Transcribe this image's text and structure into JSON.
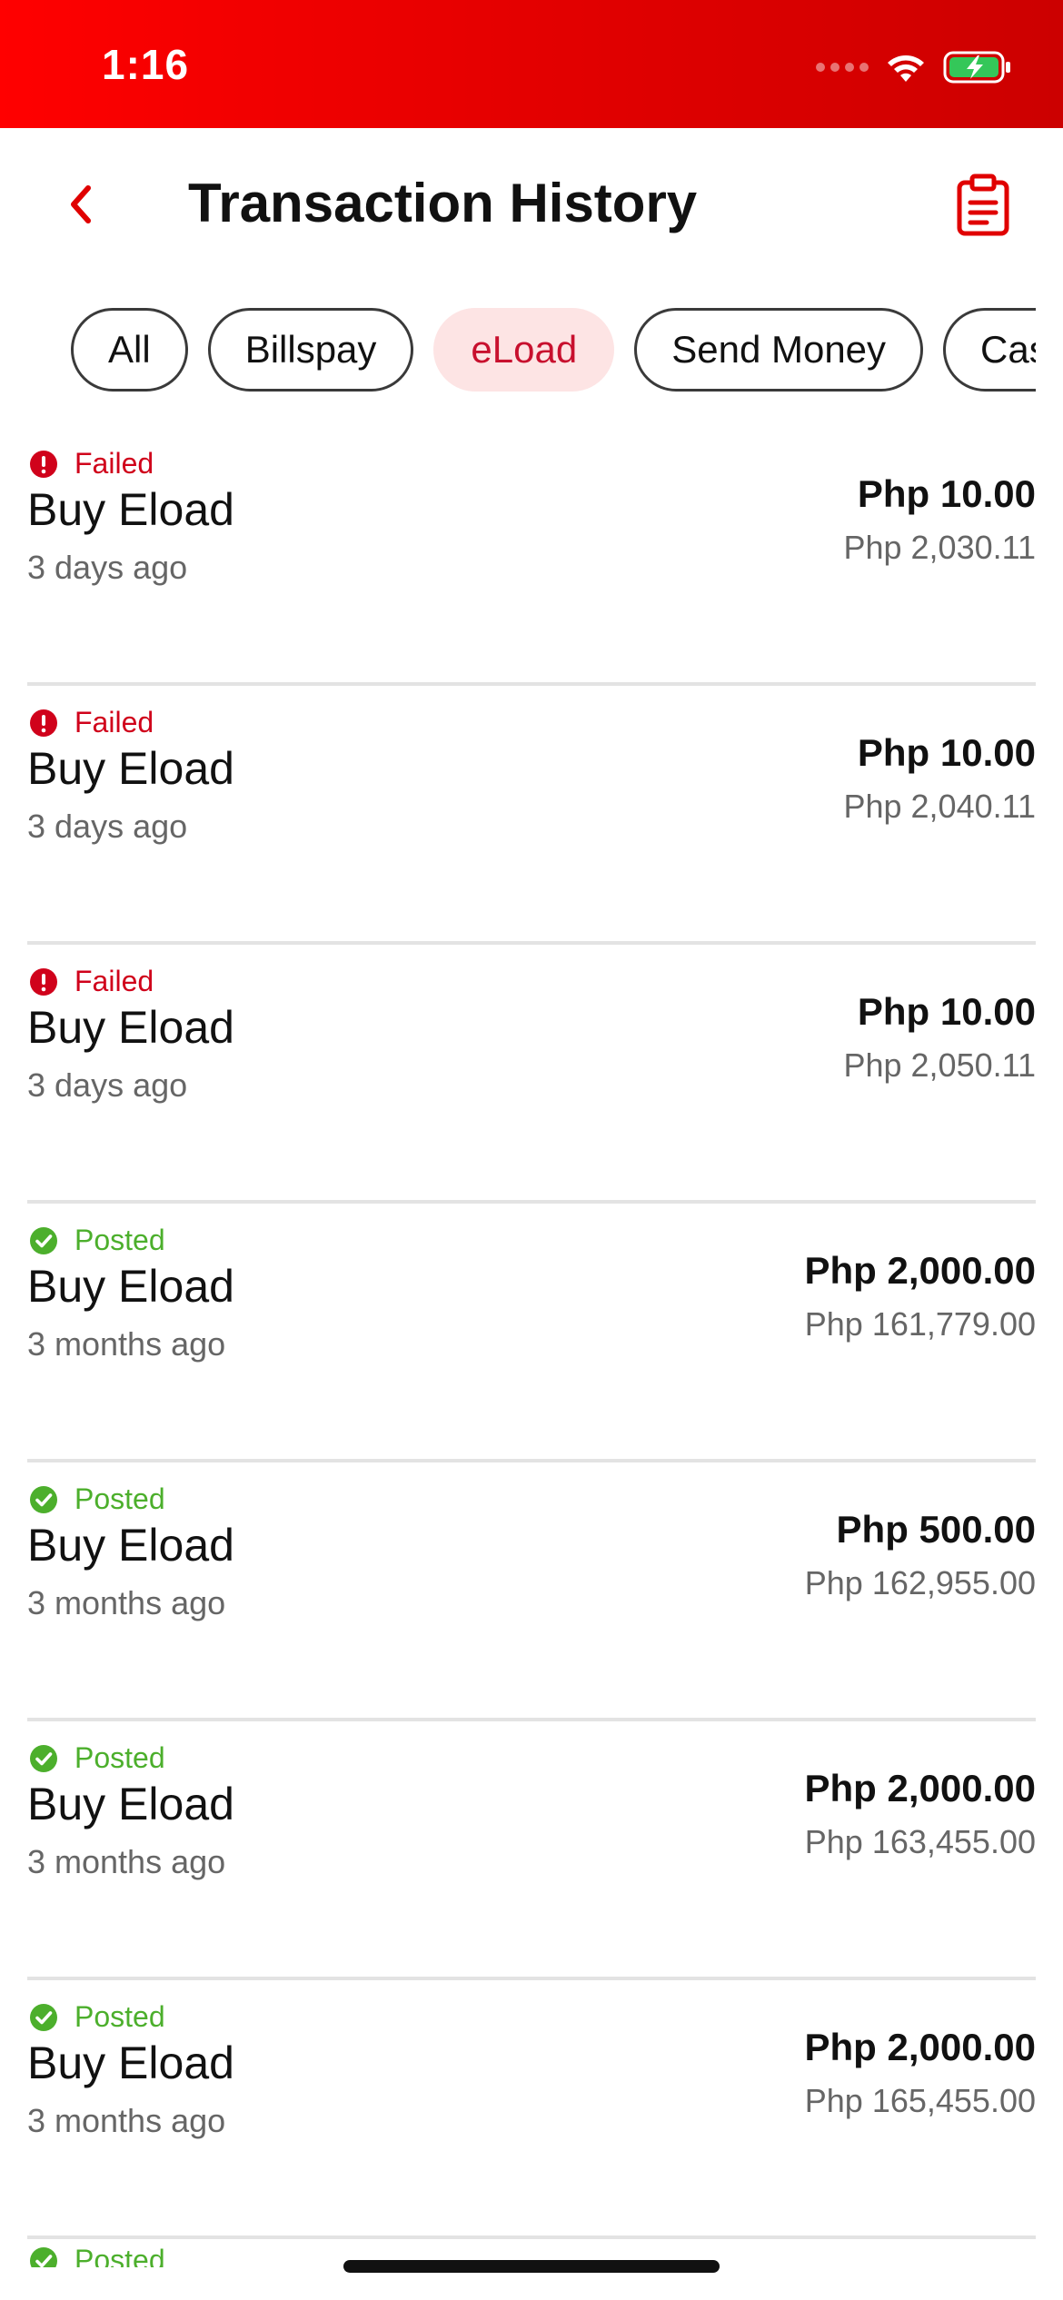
{
  "status_bar": {
    "time": "1:16"
  },
  "header": {
    "title": "Transaction History"
  },
  "filters": [
    {
      "label": "All",
      "active": false
    },
    {
      "label": "Billspay",
      "active": false
    },
    {
      "label": "eLoad",
      "active": true
    },
    {
      "label": "Send Money",
      "active": false
    },
    {
      "label": "Cash",
      "active": false
    }
  ],
  "transactions": [
    {
      "status": "Failed",
      "title": "Buy Eload",
      "time": "3 days ago",
      "amount": "Php 10.00",
      "balance": "Php 2,030.11"
    },
    {
      "status": "Failed",
      "title": "Buy Eload",
      "time": "3 days ago",
      "amount": "Php 10.00",
      "balance": "Php 2,040.11"
    },
    {
      "status": "Failed",
      "title": "Buy Eload",
      "time": "3 days ago",
      "amount": "Php 10.00",
      "balance": "Php 2,050.11"
    },
    {
      "status": "Posted",
      "title": "Buy Eload",
      "time": "3 months ago",
      "amount": "Php 2,000.00",
      "balance": "Php 161,779.00"
    },
    {
      "status": "Posted",
      "title": "Buy Eload",
      "time": "3 months ago",
      "amount": "Php 500.00",
      "balance": "Php 162,955.00"
    },
    {
      "status": "Posted",
      "title": "Buy Eload",
      "time": "3 months ago",
      "amount": "Php 2,000.00",
      "balance": "Php 163,455.00"
    },
    {
      "status": "Posted",
      "title": "Buy Eload",
      "time": "3 months ago",
      "amount": "Php 2,000.00",
      "balance": "Php 165,455.00"
    }
  ],
  "partial_row": {
    "status": "Posted"
  },
  "colors": {
    "brand_red": "#e60000",
    "failed": "#d0021b",
    "posted": "#4caf2c",
    "active_chip_bg": "#fde4e4",
    "active_chip_text": "#c8102e"
  },
  "icons": {
    "back": "chevron-left-icon",
    "history": "clipboard-icon",
    "failed": "exclamation-circle-icon",
    "posted": "check-circle-icon",
    "wifi": "wifi-icon",
    "battery": "battery-charging-icon"
  }
}
